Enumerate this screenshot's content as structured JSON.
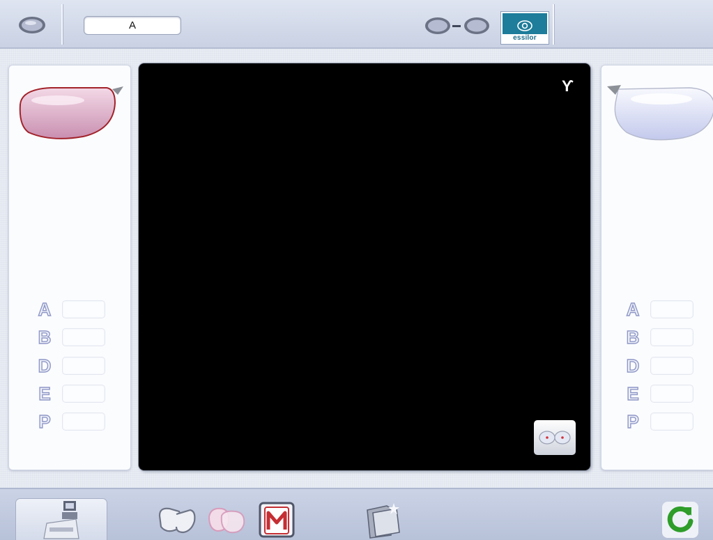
{
  "header": {
    "job_label": "A",
    "brand_name": "essilor",
    "icons": [
      "single-lens-icon",
      "lens-pair-link-icon",
      "essilor-logo"
    ]
  },
  "left_panel": {
    "side": "left",
    "lens_icon": "left-lens-tinted-icon",
    "measurements": [
      {
        "letter": "A",
        "value": ""
      },
      {
        "letter": "B",
        "value": ""
      },
      {
        "letter": "D",
        "value": ""
      },
      {
        "letter": "E",
        "value": ""
      },
      {
        "letter": "P",
        "value": ""
      }
    ]
  },
  "right_panel": {
    "side": "right",
    "lens_icon": "right-lens-clear-icon",
    "measurements": [
      {
        "letter": "A",
        "value": ""
      },
      {
        "letter": "B",
        "value": ""
      },
      {
        "letter": "D",
        "value": ""
      },
      {
        "letter": "E",
        "value": ""
      },
      {
        "letter": "P",
        "value": ""
      }
    ]
  },
  "viewer": {
    "corner_icon": "trace-mode-icon",
    "corner_symbol": "ϒ",
    "pair_button_icon": "lens-pair-dots-icon"
  },
  "toolbar": {
    "buttons": [
      "tracer-device-icon",
      "frame-shape-icon",
      "lens-overlay-icon",
      "memory-m-icon",
      "open-folder-icon",
      "refresh-icon"
    ]
  },
  "colors": {
    "accent_blue": "#1d7d9a",
    "left_lens": "#e2b6cf",
    "right_lens": "#dfe3f7",
    "refresh_green": "#2e9d2a",
    "memory_red": "#c52e33"
  }
}
